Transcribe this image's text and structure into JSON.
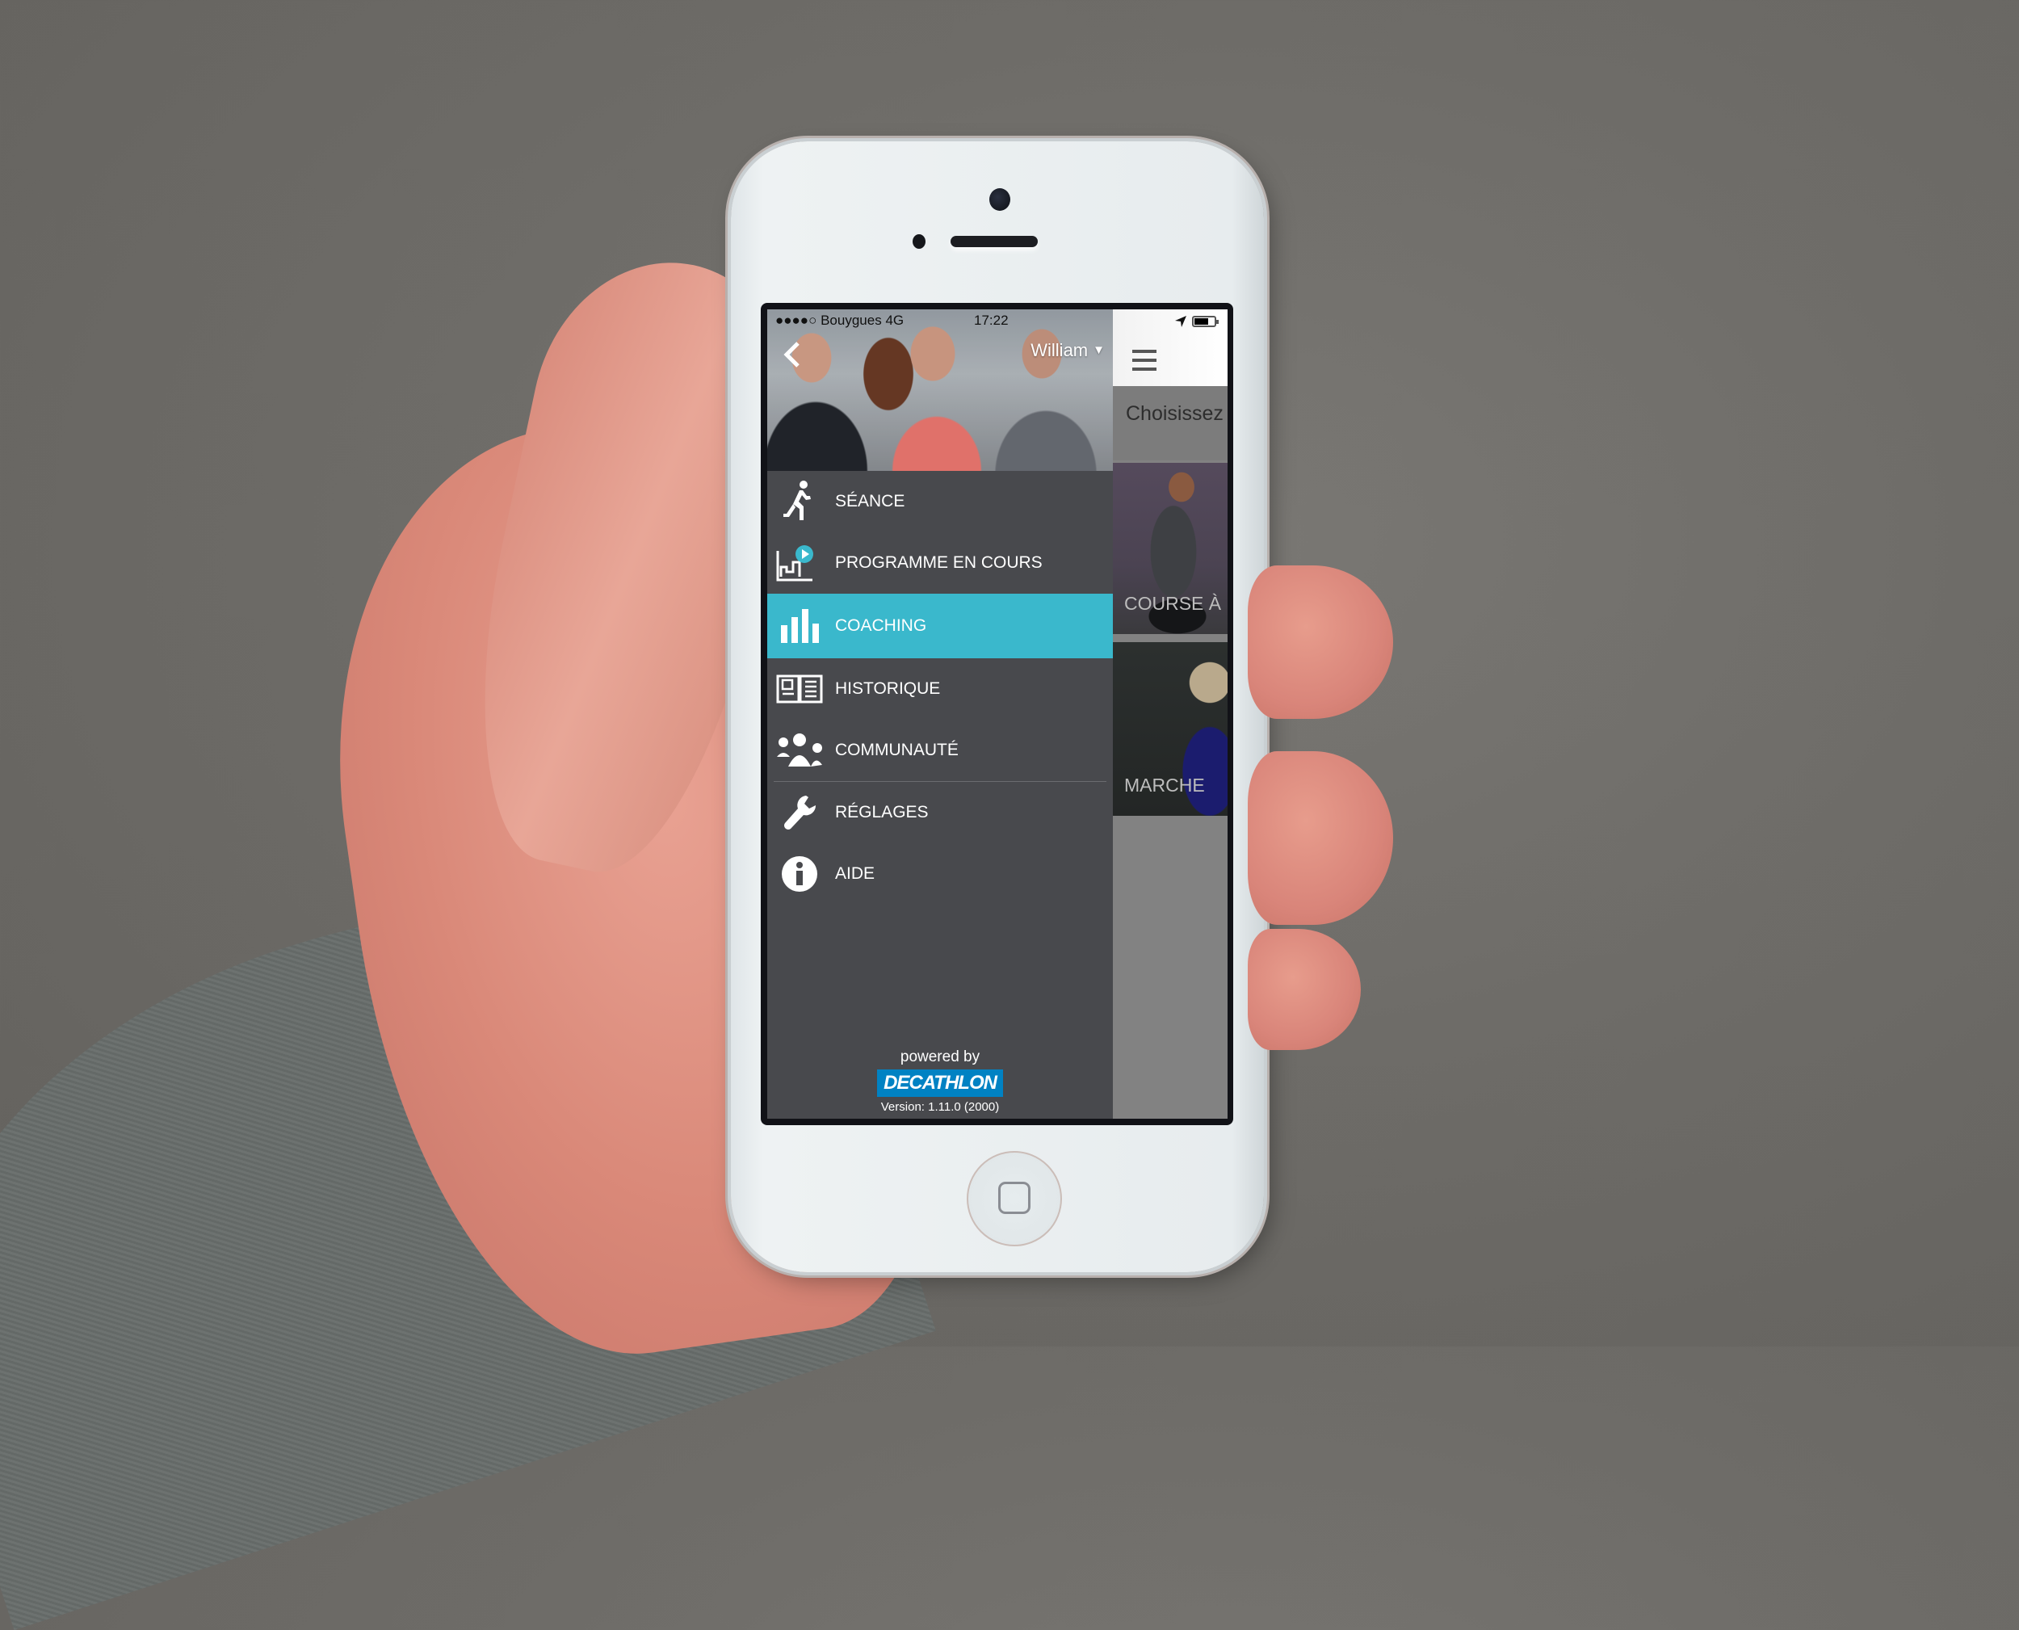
{
  "status_bar": {
    "signal": "●●●●○",
    "carrier": "Bouygues",
    "network": "4G",
    "time": "17:22",
    "battery_level": 0.65
  },
  "drawer": {
    "user_name": "William",
    "menu": [
      {
        "label": "SÉANCE",
        "icon": "running-person-icon",
        "active": false
      },
      {
        "label": "PROGRAMME EN COURS",
        "icon": "program-play-icon",
        "active": false
      },
      {
        "label": "COACHING",
        "icon": "bar-chart-icon",
        "active": true
      },
      {
        "label": "HISTORIQUE",
        "icon": "book-icon",
        "active": false
      },
      {
        "label": "COMMUNAUTÉ",
        "icon": "people-icon",
        "active": false
      },
      {
        "label": "RÉGLAGES",
        "icon": "wrench-icon",
        "active": false
      },
      {
        "label": "AIDE",
        "icon": "info-icon",
        "active": false
      }
    ],
    "footer": {
      "powered_by": "powered by",
      "brand": "DECATHLON",
      "version": "Version: 1.11.0 (2000)"
    }
  },
  "content": {
    "prompt": "Choisissez",
    "cards": [
      {
        "label": "COURSE À"
      },
      {
        "label": "MARCHE"
      }
    ]
  },
  "colors": {
    "accent": "#3ab8cc",
    "drawer_bg": "#48494d",
    "brand_blue": "#0082c3"
  }
}
